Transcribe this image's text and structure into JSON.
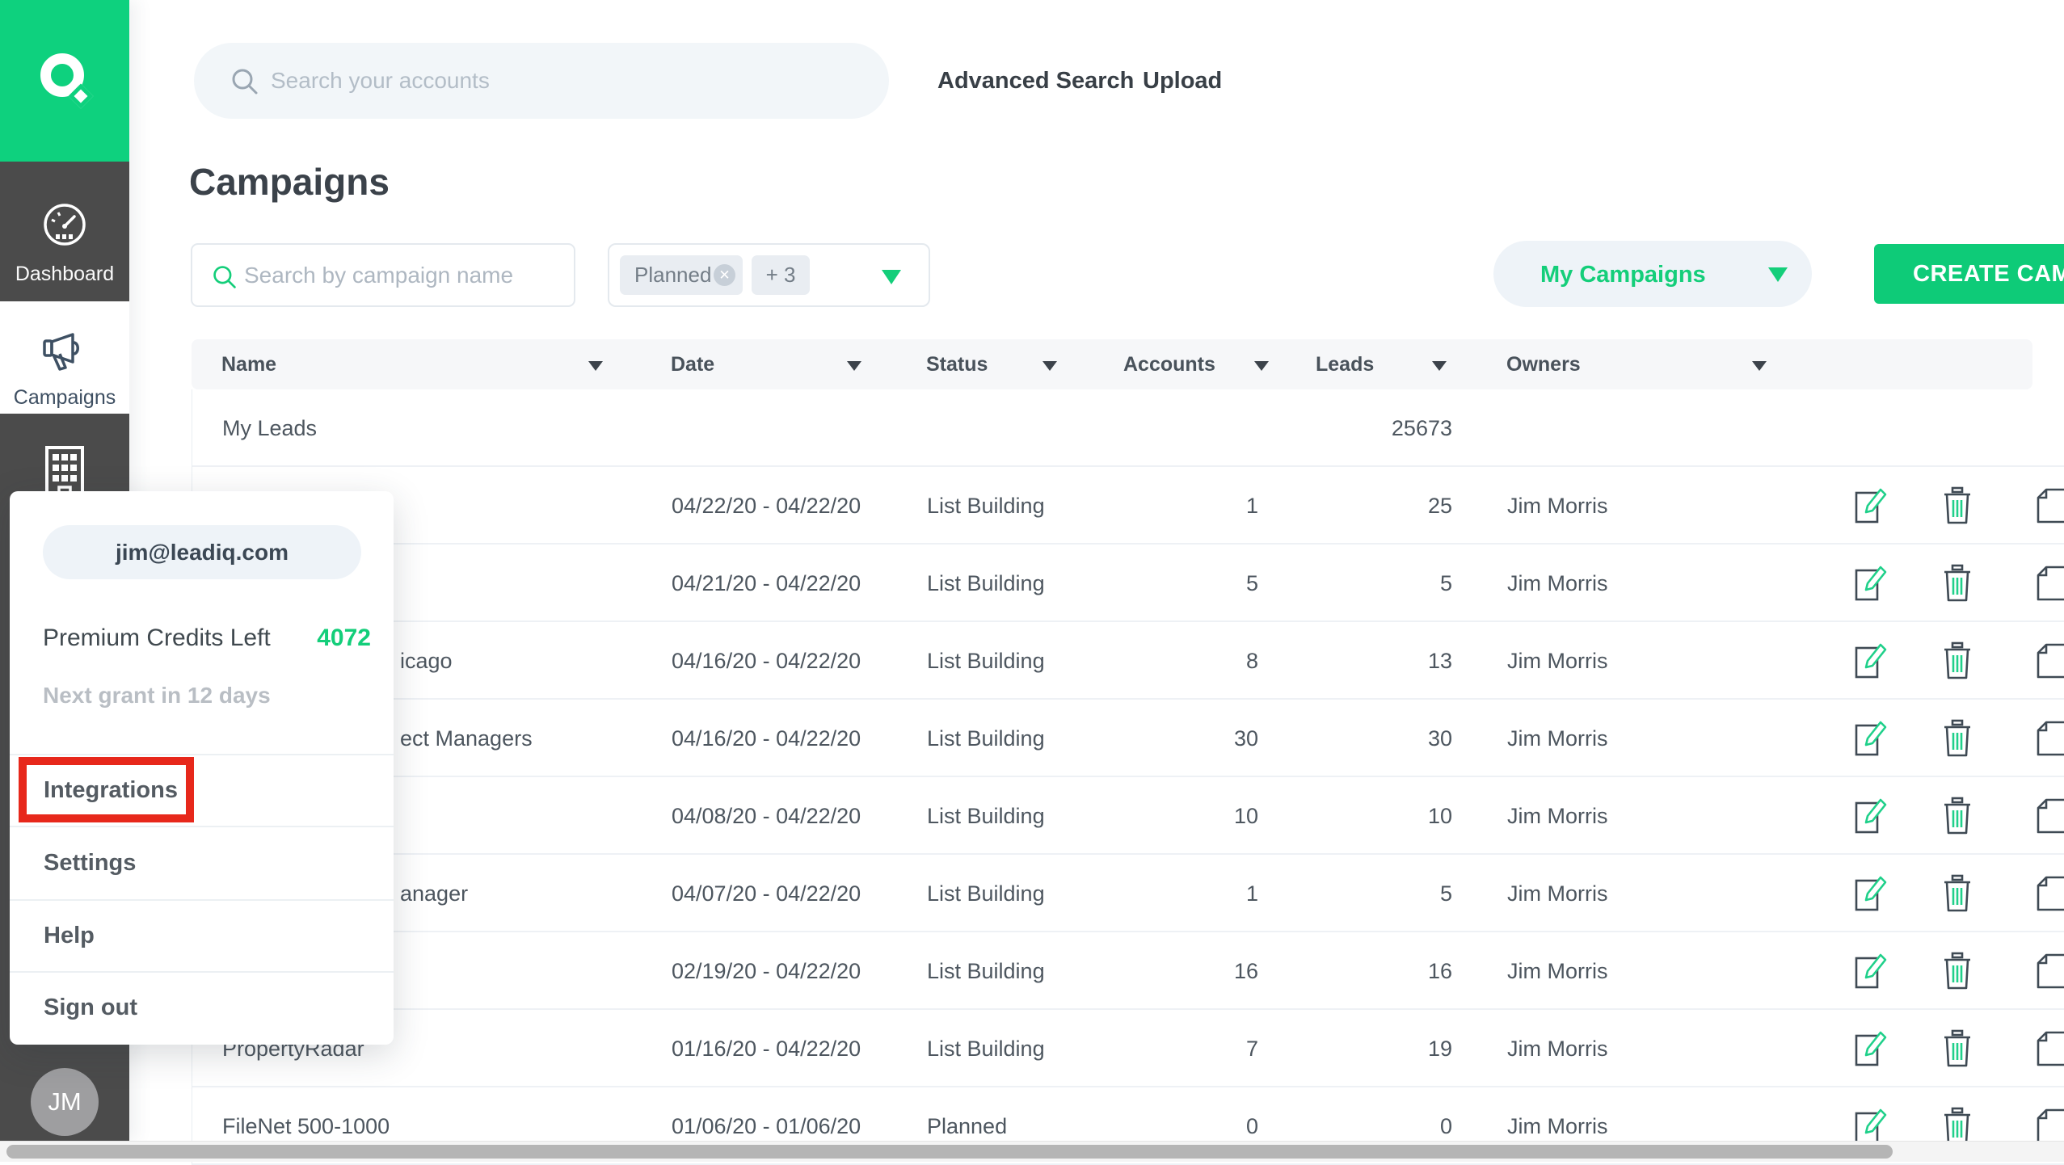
{
  "colors": {
    "brand_green": "#0ed17e",
    "accent_green": "#14ce7a",
    "sidebar_dark": "#4b4b4b",
    "highlight_red": "#e7281b"
  },
  "sidebar": {
    "logo": "Q",
    "items": [
      {
        "label": "Dashboard"
      },
      {
        "label": "Campaigns",
        "active": true
      },
      {
        "label": "",
        "icon": "building"
      }
    ],
    "avatar_initials": "JM"
  },
  "topbar": {
    "search_placeholder": "Search your accounts",
    "advanced_search": "Advanced Search",
    "upload": "Upload"
  },
  "page": {
    "title": "Campaigns"
  },
  "controls": {
    "campaign_search_placeholder": "Search by campaign name",
    "filter_chip": "Planned",
    "filter_more": "+ 3",
    "scope_select": "My Campaigns",
    "create_button": "CREATE CAMPAIGN"
  },
  "table": {
    "columns": [
      "Name",
      "Date",
      "Status",
      "Accounts",
      "Leads",
      "Owners"
    ],
    "rows": [
      {
        "name": "My Leads",
        "date": "",
        "status": "",
        "accounts": "",
        "leads": "25673",
        "owners": "",
        "actions": false,
        "name_offset": false
      },
      {
        "name": "",
        "date": "04/22/20 - 04/22/20",
        "status": "List Building",
        "accounts": "1",
        "leads": "25",
        "owners": "Jim Morris",
        "actions": true,
        "name_offset": false
      },
      {
        "name": "",
        "date": "04/21/20 - 04/22/20",
        "status": "List Building",
        "accounts": "5",
        "leads": "5",
        "owners": "Jim Morris",
        "actions": true,
        "name_offset": false
      },
      {
        "name": "icago",
        "date": "04/16/20 - 04/22/20",
        "status": "List Building",
        "accounts": "8",
        "leads": "13",
        "owners": "Jim Morris",
        "actions": true,
        "name_offset": true
      },
      {
        "name": "ect Managers",
        "date": "04/16/20 - 04/22/20",
        "status": "List Building",
        "accounts": "30",
        "leads": "30",
        "owners": "Jim Morris",
        "actions": true,
        "name_offset": true
      },
      {
        "name": "",
        "date": "04/08/20 - 04/22/20",
        "status": "List Building",
        "accounts": "10",
        "leads": "10",
        "owners": "Jim Morris",
        "actions": true,
        "name_offset": false
      },
      {
        "name": "anager",
        "date": "04/07/20 - 04/22/20",
        "status": "List Building",
        "accounts": "1",
        "leads": "5",
        "owners": "Jim Morris",
        "actions": true,
        "name_offset": true
      },
      {
        "name": "",
        "date": "02/19/20 - 04/22/20",
        "status": "List Building",
        "accounts": "16",
        "leads": "16",
        "owners": "Jim Morris",
        "actions": true,
        "name_offset": false
      },
      {
        "name": "PropertyRadar",
        "date": "01/16/20 - 04/22/20",
        "status": "List Building",
        "accounts": "7",
        "leads": "19",
        "owners": "Jim Morris",
        "actions": true,
        "name_offset": false
      },
      {
        "name": "FileNet 500-1000",
        "date": "01/06/20 - 01/06/20",
        "status": "Planned",
        "accounts": "0",
        "leads": "0",
        "owners": "Jim Morris",
        "actions": true,
        "name_offset": false
      }
    ]
  },
  "account_menu": {
    "email": "jim@leadiq.com",
    "credits_label": "Premium Credits Left",
    "credits_value": "4072",
    "grant_note": "Next grant in 12 days",
    "items": [
      "Integrations",
      "Settings",
      "Help",
      "Sign out"
    ],
    "highlighted_item": "Integrations"
  }
}
